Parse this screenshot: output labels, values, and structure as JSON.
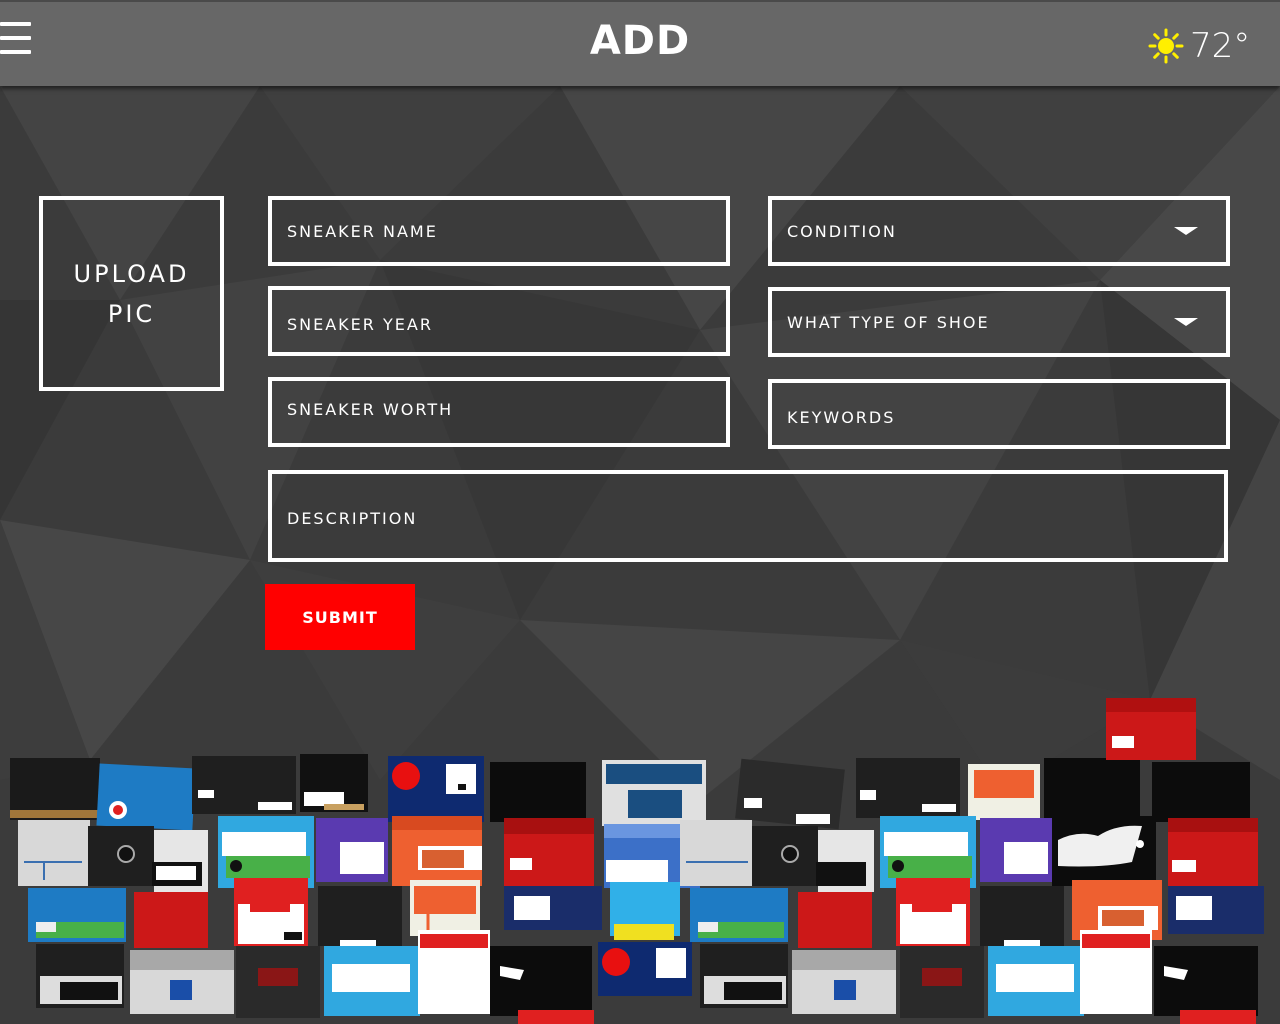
{
  "header": {
    "title": "ADD",
    "temperature": "72°",
    "weather_icon": "sun-icon",
    "menu_icon": "hamburger-icon"
  },
  "form": {
    "upload_line1": "UPLOAD",
    "upload_line2": "PIC",
    "sneaker_name": "SNEAKER NAME",
    "sneaker_year": "SNEAKER YEAR",
    "sneaker_worth": "SNEAKER WORTH",
    "condition": "CONDITION",
    "shoe_type": "WHAT TYPE OF SHOE",
    "keywords": "KEYWORDS",
    "description": "DESCRIPTION",
    "submit": "SUBMIT"
  },
  "colors": {
    "accent": "#ff0000",
    "header_bg": "#676767",
    "page_bg": "#3a3a3a",
    "sun": "#ffef00"
  }
}
